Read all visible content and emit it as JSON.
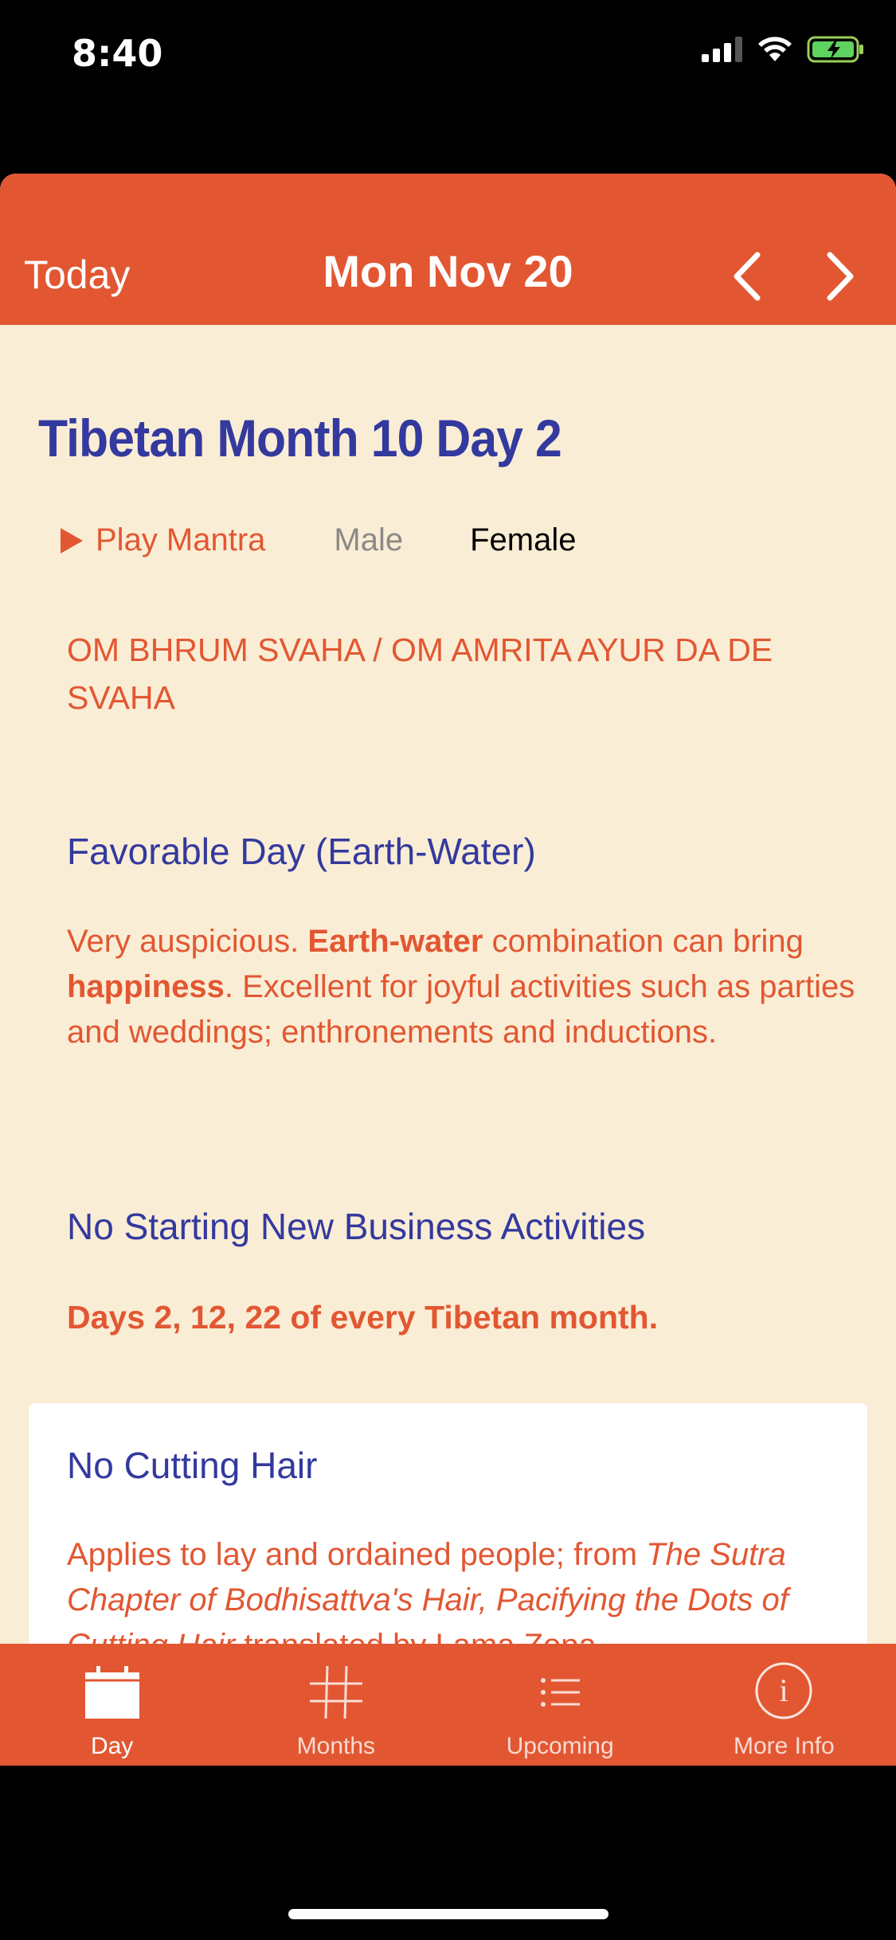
{
  "status_bar": {
    "time": "8:40"
  },
  "nav": {
    "today_label": "Today",
    "title": "Mon Nov 20"
  },
  "content": {
    "heading": "Tibetan Month 10 Day 2",
    "mantra_controls": {
      "play_label": "Play Mantra",
      "male_label": "Male",
      "female_label": "Female"
    },
    "mantra_text": "OM BHRUM SVAHA / OM AMRITA AYUR DA DE SVAHA",
    "sections": [
      {
        "title": "Favorable Day (Earth-Water)",
        "body_parts": [
          "Very auspicious. ",
          "Earth-water",
          " combination can bring ",
          "happiness",
          ". Excellent for joyful activities such as parties and weddings; enthronements and inductions."
        ]
      },
      {
        "title": "No Starting New Business Activities",
        "body": "Days 2, 12, 22 of every Tibetan month."
      },
      {
        "title": "No Cutting Hair",
        "body_parts": [
          "Applies to lay and ordained people; from ",
          "The Sutra Chapter of Bodhisattva's Hair, Pacifying the Dots of Cutting Hair",
          " translated by Lama Zopa"
        ]
      }
    ]
  },
  "tabs": [
    {
      "label": "Day",
      "icon": "calendar-icon",
      "selected": true
    },
    {
      "label": "Months",
      "icon": "grid-icon",
      "selected": false
    },
    {
      "label": "Upcoming",
      "icon": "list-icon",
      "selected": false
    },
    {
      "label": "More Info",
      "icon": "info-icon",
      "selected": false
    }
  ],
  "colors": {
    "accent": "#E25732",
    "background": "#FAEDD5",
    "heading": "#33399E",
    "card": "#FFFFFF"
  }
}
